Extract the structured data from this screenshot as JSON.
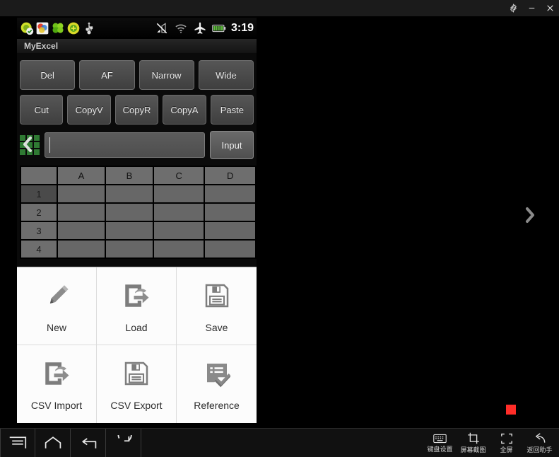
{
  "window": {
    "controls": [
      {
        "name": "settings",
        "icon": "gear-icon"
      },
      {
        "name": "minimize",
        "icon": "minimize-icon"
      },
      {
        "name": "close",
        "icon": "close-icon"
      }
    ]
  },
  "device": {
    "status_bar": {
      "notification_icons": [
        "app-sync-icon",
        "gallery-icon",
        "clover-icon",
        "app-plus-icon",
        "usb-icon"
      ],
      "system_icons": [
        "no-signal-icon",
        "wifi-icon",
        "airplane-mode-icon",
        "battery-icon"
      ],
      "time": "3:19"
    },
    "app_title": "MyExcel",
    "toolbar_row1": [
      {
        "label": "Del"
      },
      {
        "label": "AF"
      },
      {
        "label": "Narrow"
      },
      {
        "label": "Wide"
      }
    ],
    "toolbar_row2": [
      {
        "label": "Cut"
      },
      {
        "label": "CopyV"
      },
      {
        "label": "CopyR"
      },
      {
        "label": "CopyA"
      },
      {
        "label": "Paste"
      }
    ],
    "formula_bar": {
      "grid_icon": "grid-icon",
      "value": "",
      "placeholder": "",
      "input_button": "Input"
    },
    "sheet": {
      "columns": [
        "",
        "A",
        "B",
        "C",
        "D"
      ],
      "rows": [
        {
          "header": "1",
          "cells": [
            "",
            "",
            "",
            ""
          ]
        },
        {
          "header": "2",
          "cells": [
            "",
            "",
            "",
            ""
          ]
        },
        {
          "header": "3",
          "cells": [
            "",
            "",
            "",
            ""
          ]
        },
        {
          "header": "4",
          "cells": [
            "",
            "",
            "",
            ""
          ]
        }
      ],
      "selected_row": "1"
    },
    "menu": {
      "items": [
        {
          "label": "New",
          "icon": "pencil-icon"
        },
        {
          "label": "Load",
          "icon": "import-icon"
        },
        {
          "label": "Save",
          "icon": "floppy-disk-icon"
        },
        {
          "label": "CSV Import",
          "icon": "import-icon"
        },
        {
          "label": "CSV Export",
          "icon": "floppy-disk-icon"
        },
        {
          "label": "Reference",
          "icon": "checklist-icon"
        }
      ]
    }
  },
  "overlay": {
    "prev_arrow": "chevron-left-icon",
    "next_arrow": "chevron-right-icon",
    "recording_indicator": "#ff2d28"
  },
  "navbar": {
    "system_buttons": [
      {
        "name": "menu",
        "icon": "menu-icon"
      },
      {
        "name": "home",
        "icon": "home-icon"
      },
      {
        "name": "back",
        "icon": "back-icon"
      },
      {
        "name": "rotate",
        "icon": "rotate-icon"
      }
    ],
    "tools": [
      {
        "label": "键盘设置",
        "icon": "keyboard-icon"
      },
      {
        "label": "屏幕截图",
        "icon": "screenshot-icon"
      },
      {
        "label": "全屏",
        "icon": "fullscreen-icon"
      },
      {
        "label": "返回助手",
        "icon": "return-assistant-icon"
      }
    ]
  }
}
